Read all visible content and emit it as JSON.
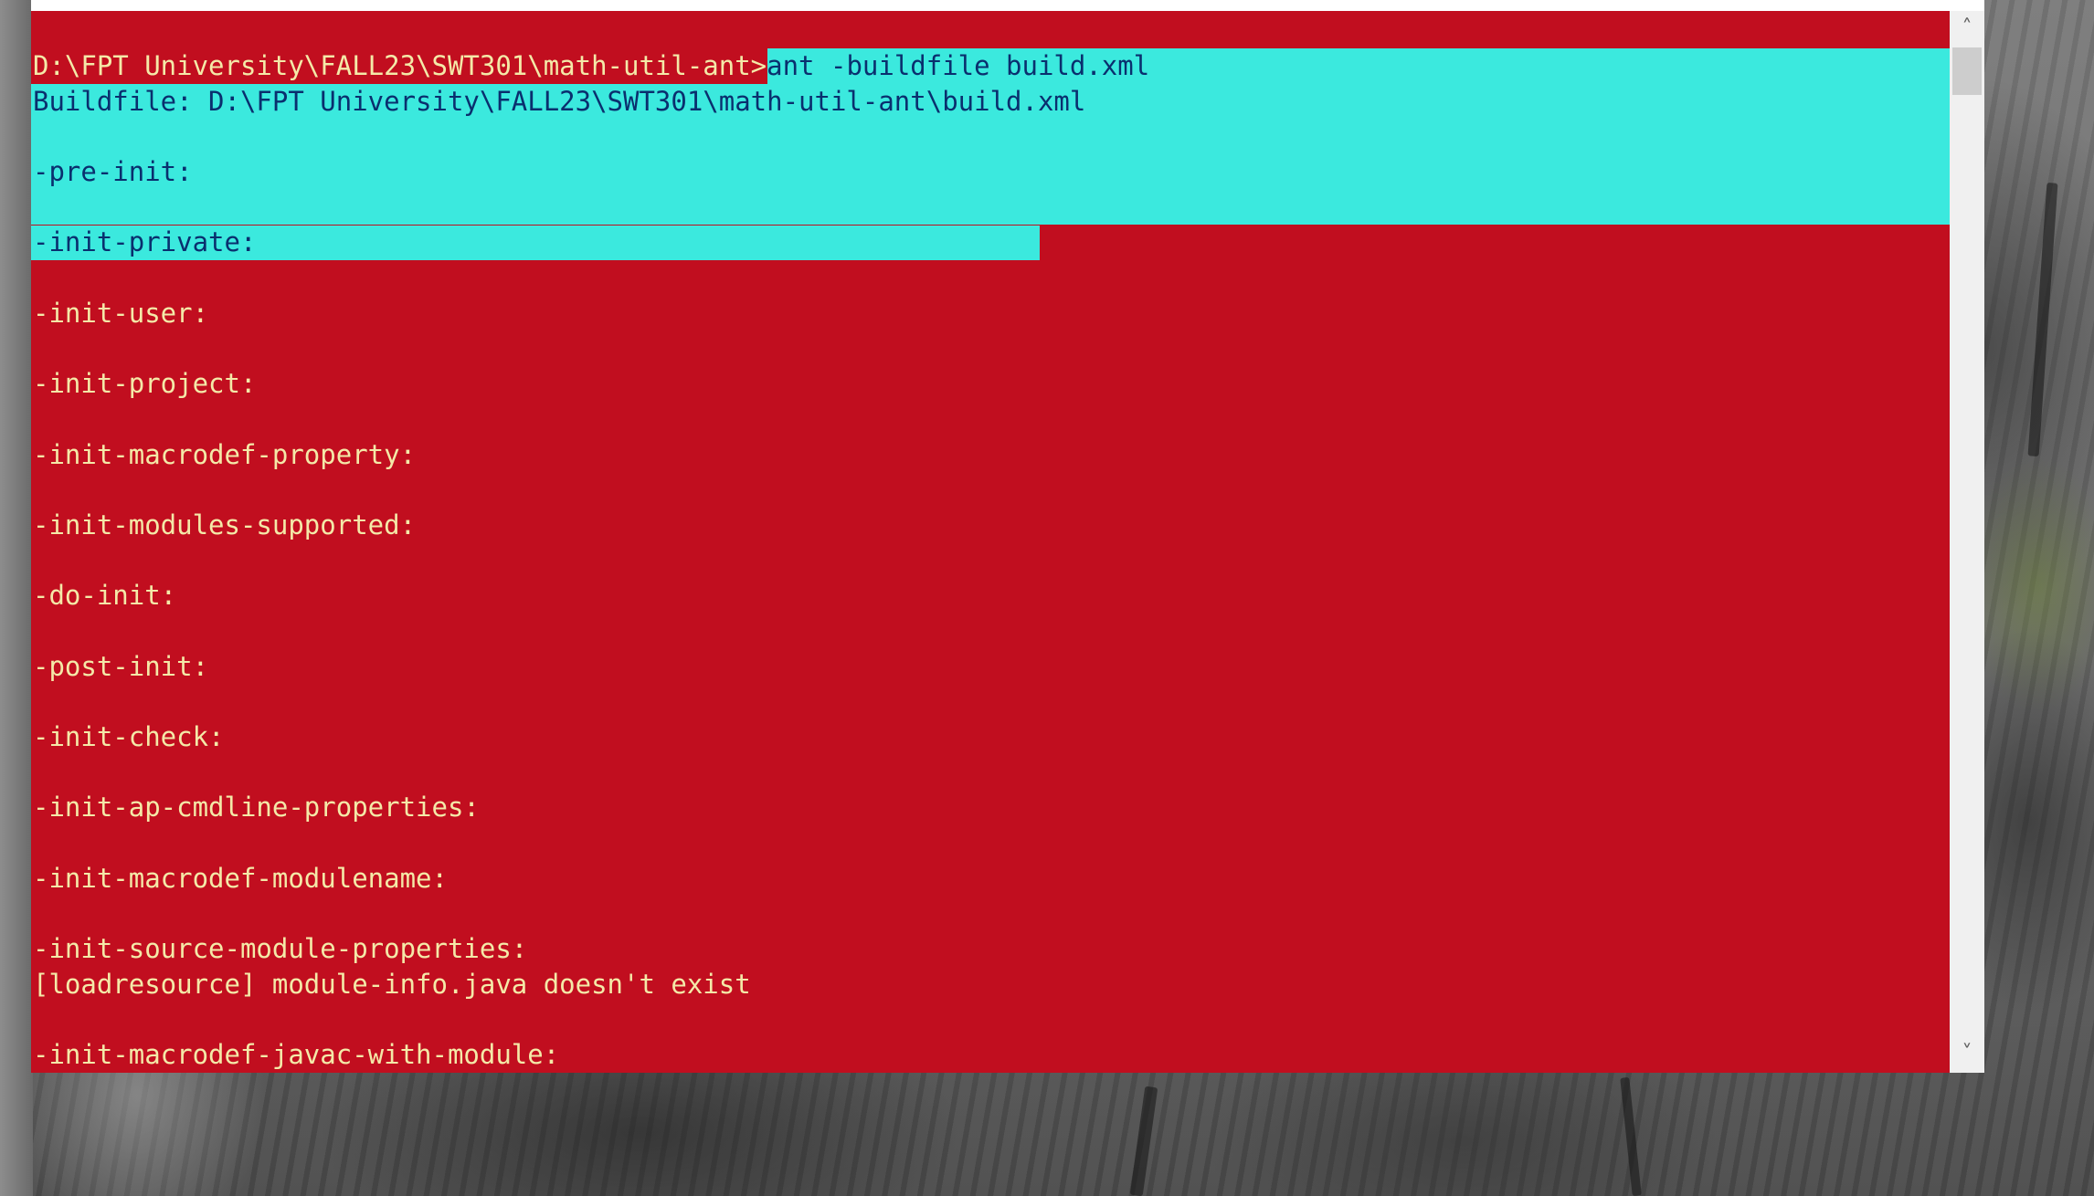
{
  "console": {
    "prompt": "D:\\FPT University\\FALL23\\SWT301\\math-util-ant>",
    "command": "ant -buildfile build.xml",
    "lines": [
      "Buildfile: D:\\FPT University\\FALL23\\SWT301\\math-util-ant\\build.xml",
      "",
      "-pre-init:",
      "",
      "-init-private:",
      "",
      "-init-user:",
      "",
      "-init-project:",
      "",
      "-init-macrodef-property:",
      "",
      "-init-modules-supported:",
      "",
      "-do-init:",
      "",
      "-post-init:",
      "",
      "-init-check:",
      "",
      "-init-ap-cmdline-properties:",
      "",
      "-init-macrodef-modulename:",
      "",
      "-init-source-module-properties:",
      "[loadresource] module-info.java doesn't exist",
      "",
      "-init-macrodef-javac-with-module:"
    ]
  },
  "scrollbar": {
    "up_icon": "chevron-up-icon",
    "down_icon": "chevron-down-icon",
    "up_glyph": "˄",
    "down_glyph": "˅"
  },
  "colors": {
    "background": "#c10e1f",
    "text": "#f4e9a8",
    "selection": "#3be9de",
    "selection_text": "#0a2f6e"
  }
}
